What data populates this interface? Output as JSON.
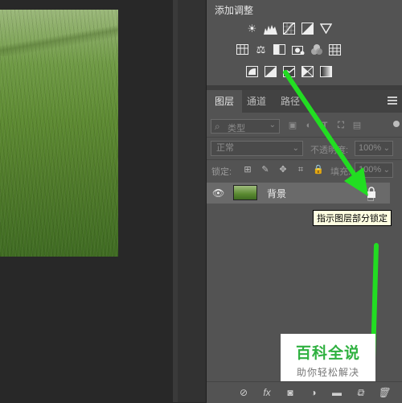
{
  "adjustments": {
    "title": "添加调整",
    "row1": [
      "brightness-icon",
      "levels-icon",
      "curves-icon",
      "exposure-icon",
      "vibrance-icon"
    ],
    "row2": [
      "hue-saturation-icon",
      "color-balance-icon",
      "black-white-icon",
      "photo-filter-icon",
      "channel-mixer-icon",
      "color-lookup-icon"
    ],
    "row3": [
      "invert-icon",
      "posterize-icon",
      "threshold-icon",
      "selective-color-icon",
      "gradient-map-icon"
    ]
  },
  "tabs": [
    {
      "label": "图层",
      "active": true
    },
    {
      "label": "通道",
      "active": false
    },
    {
      "label": "路径",
      "active": false
    }
  ],
  "filter": {
    "label": "类型"
  },
  "blend_mode": "正常",
  "opacity": {
    "label": "不透明度:",
    "value": "100%"
  },
  "lock": {
    "label": "锁定:"
  },
  "fill": {
    "label": "填充:",
    "value": "100%"
  },
  "layer": {
    "name": "背景"
  },
  "tooltip": "指示图层部分锁定",
  "watermark": {
    "title": "百科全说",
    "subtitle": "助你轻松解决"
  },
  "colors": {
    "arrow": "#22dd22",
    "panel": "#535353",
    "watermark_green": "#2fb140"
  }
}
